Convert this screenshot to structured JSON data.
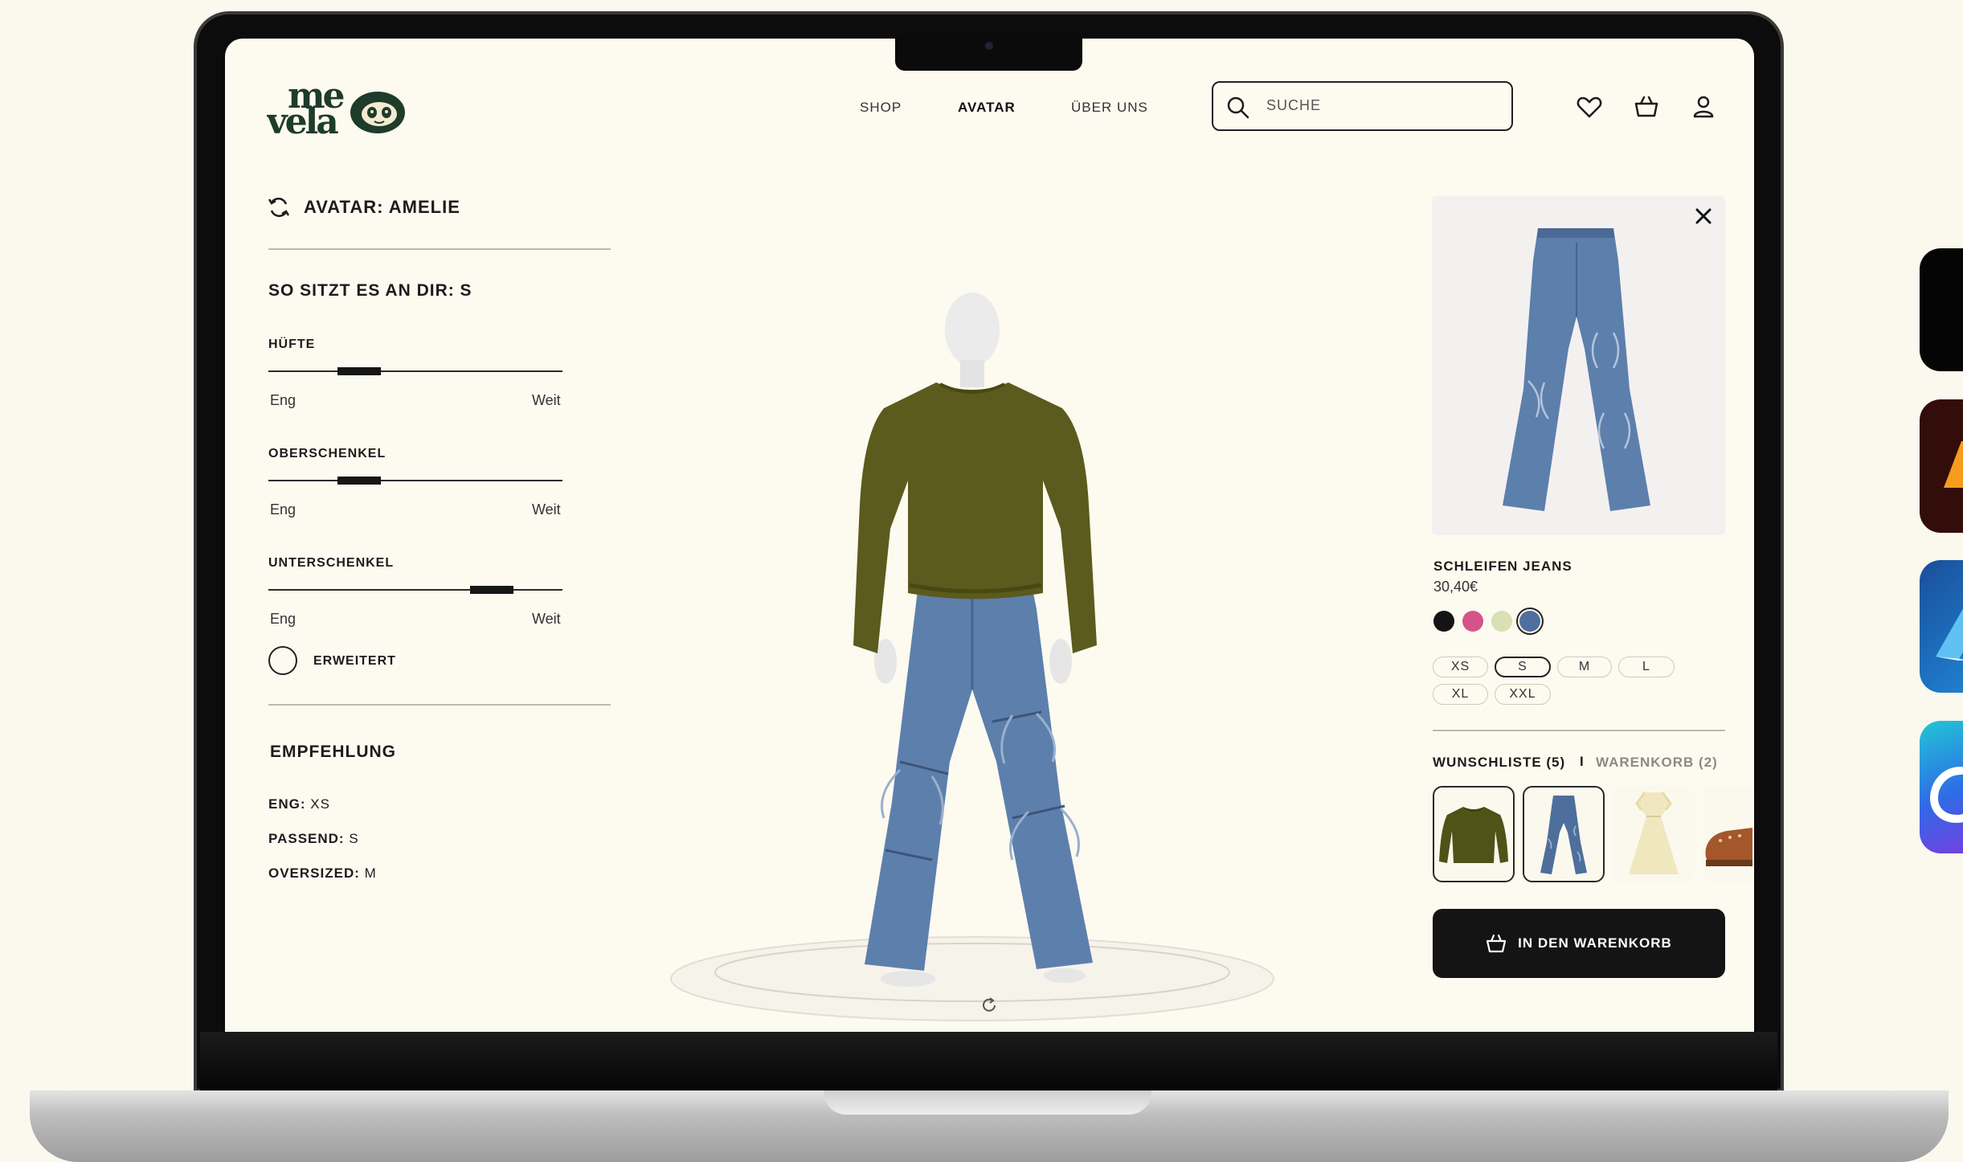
{
  "brand": {
    "name": "me vela"
  },
  "nav": {
    "shop": "SHOP",
    "avatar": "AVATAR",
    "about": "ÜBER UNS"
  },
  "search": {
    "placeholder": "SUCHE"
  },
  "avatar": {
    "title": "AVATAR: AMELIE"
  },
  "fit": {
    "title": "SO SITZT ES AN DIR: S",
    "sliders": [
      {
        "label": "HÜFTE",
        "min_label": "Eng",
        "max_label": "Weit",
        "value": 0.31
      },
      {
        "label": "OBERSCHENKEL",
        "min_label": "Eng",
        "max_label": "Weit",
        "value": 0.31
      },
      {
        "label": "UNTERSCHENKEL",
        "min_label": "Eng",
        "max_label": "Weit",
        "value": 0.76
      }
    ],
    "advanced_label": "ERWEITERT"
  },
  "recommendation": {
    "title": "EMPFEHLUNG",
    "items": [
      {
        "label": "ENG:",
        "value": "XS"
      },
      {
        "label": "PASSEND:",
        "value": "S"
      },
      {
        "label": "OVERSIZED:",
        "value": "M"
      }
    ]
  },
  "product": {
    "name": "SCHLEIFEN JEANS",
    "price": "30,40€",
    "colors": [
      "#141414",
      "#d4548a",
      "#d7e1b3",
      "#4f6f9e"
    ],
    "selected_color": "#4f6f9e",
    "sizes": [
      "XS",
      "S",
      "M",
      "L",
      "XL",
      "XXL"
    ],
    "selected_size": "S"
  },
  "tabs": {
    "wishlist": "WUNSCHLISTE (5)",
    "separator": "I",
    "cart": "WARENKORB (2)"
  },
  "wishlist_items": [
    {
      "icon": "sweater-icon",
      "selected": true
    },
    {
      "icon": "jeans-icon",
      "selected": true
    },
    {
      "icon": "dress-icon",
      "selected": false
    },
    {
      "icon": "shoe-icon",
      "selected": false
    }
  ],
  "cta": {
    "label": "IN DEN WARENKORB"
  },
  "colors": {
    "background": "#fdfaf0",
    "ink": "#141414",
    "brand_green": "#1f3b2a",
    "sweater": "#5a5b1c",
    "denim": "#5d7fac"
  }
}
